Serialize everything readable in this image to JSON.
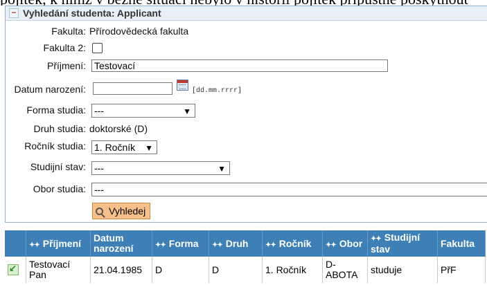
{
  "top_strip": "pojítek, k nimž v běžné situaci nebylo v historii pojítek přípustné poskytnout",
  "panel": {
    "title": "Vyhledání studenta: Applicant",
    "fakulta_label": "Fakulta:",
    "fakulta_value": "Přírodovědecká fakulta",
    "fakulta2_label": "Fakulta 2:",
    "prijmeni_label": "Příjmení:",
    "prijmeni_value": "Testovací",
    "datum_label": "Datum narození:",
    "datum_value": "",
    "datum_hint": "[dd.mm.rrrr]",
    "forma_label": "Forma studia:",
    "forma_value": "---",
    "druh_label": "Druh studia:",
    "druh_value": "doktorské (D)",
    "rocnik_label": "Ročník studia:",
    "rocnik_value": "1. Ročník",
    "stav_label": "Studijní stav:",
    "stav_value": "---",
    "obor_label": "Obor studia:",
    "obor_value": "---",
    "search_label": "Vyhledej"
  },
  "table": {
    "headers": {
      "prijmeni": "Příjmení",
      "datum_1": "Datum",
      "datum_2": "narození",
      "forma": "Forma",
      "druh": "Druh",
      "rocnik": "Ročník",
      "obor": "Obor",
      "stav_1": "Studijní",
      "stav_2": "stav",
      "fakulta": "Fakulta"
    },
    "rows": [
      {
        "prijmeni_1": "Testovací",
        "prijmeni_2": "Pan",
        "datum": "21.04.1985",
        "forma": "D",
        "druh": "D",
        "rocnik": "1. Ročník",
        "obor_1": "D-",
        "obor_2": "ABOTA",
        "stav": "studuje",
        "fakulta": "PřF"
      }
    ]
  },
  "icons": {
    "collapse": "minus-icon",
    "calendar": "calendar-icon",
    "search": "magnifier-icon",
    "sort": "sort-arrows-icon",
    "row_select": "select-arrow-icon"
  },
  "colors": {
    "header_bg": "#3e80b6",
    "button_bg": "#f7c08a",
    "panel_border": "#8fb0cf"
  }
}
